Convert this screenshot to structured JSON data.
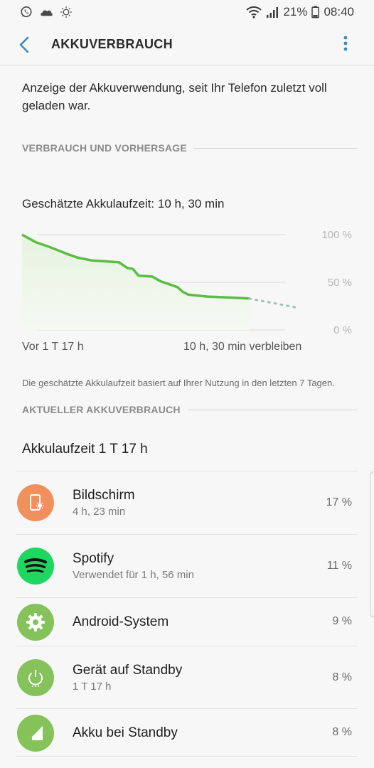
{
  "status_bar": {
    "battery_percent": "21%",
    "time": "08:40"
  },
  "header": {
    "title": "AKKUVERBRAUCH"
  },
  "intro": "Anzeige der Akkuverwendung, seit Ihr Telefon zuletzt voll geladen war.",
  "section_forecast": "VERBRAUCH UND VORHERSAGE",
  "estimate": "Geschätzte Akkulaufzeit: 10 h, 30 min",
  "chart_data": {
    "type": "area",
    "y_tick_labels": [
      "100 %",
      "50 %",
      "0 %"
    ],
    "ylim": [
      0,
      100
    ],
    "x_labels": {
      "start": "Vor 1 T 17 h",
      "end": "10 h, 30 min verbleiben"
    },
    "grid": true,
    "colors": {
      "line": "#5bbd44",
      "fill": "#e6f3e0",
      "forecast": "#a6bcbc"
    },
    "series": [
      {
        "values": [
          [
            0,
            100
          ],
          [
            0.05,
            92
          ],
          [
            0.1,
            87
          ],
          [
            0.16,
            80
          ],
          [
            0.2,
            76
          ],
          [
            0.25,
            73
          ],
          [
            0.3,
            72
          ],
          [
            0.35,
            71
          ],
          [
            0.38,
            65
          ],
          [
            0.4,
            64
          ],
          [
            0.42,
            57
          ],
          [
            0.47,
            56
          ],
          [
            0.5,
            51
          ],
          [
            0.56,
            45
          ],
          [
            0.58,
            40
          ],
          [
            0.6,
            37
          ],
          [
            0.67,
            35
          ],
          [
            0.75,
            34
          ],
          [
            0.82,
            33
          ]
        ]
      },
      {
        "values": [
          [
            0.82,
            33
          ],
          [
            1.0,
            23
          ]
        ],
        "style": "dotted"
      }
    ]
  },
  "chart_start_label": "Vor 1 T 17 h",
  "chart_end_label": "10 h, 30 min verbleiben",
  "footnote": "Die geschätzte Akkulaufzeit basiert auf Ihrer Nutzung in den letzten 7 Tagen.",
  "section_current": "AKTUELLER AKKUVERBRAUCH",
  "runtime": "Akkulaufzeit 1 T 17 h",
  "apps": [
    {
      "name": "Bildschirm",
      "sub": "4 h, 23 min",
      "pct": "17 %",
      "icon": "display-brightness-icon",
      "color": "#f0915d"
    },
    {
      "name": "Spotify",
      "sub": "Verwendet für 1 h, 56 min",
      "pct": "11 %",
      "icon": "spotify-icon",
      "color": "#1ed760"
    },
    {
      "name": "Android-System",
      "sub": "",
      "pct": "9 %",
      "icon": "gear-icon",
      "color": "#86c25a"
    },
    {
      "name": "Gerät auf Standby",
      "sub": "1 T 17 h",
      "pct": "8 %",
      "icon": "power-standby-icon",
      "color": "#86c25a"
    },
    {
      "name": "Akku bei Standby",
      "sub": "",
      "pct": "8 %",
      "icon": "signal-standby-icon",
      "color": "#86c25a"
    }
  ]
}
